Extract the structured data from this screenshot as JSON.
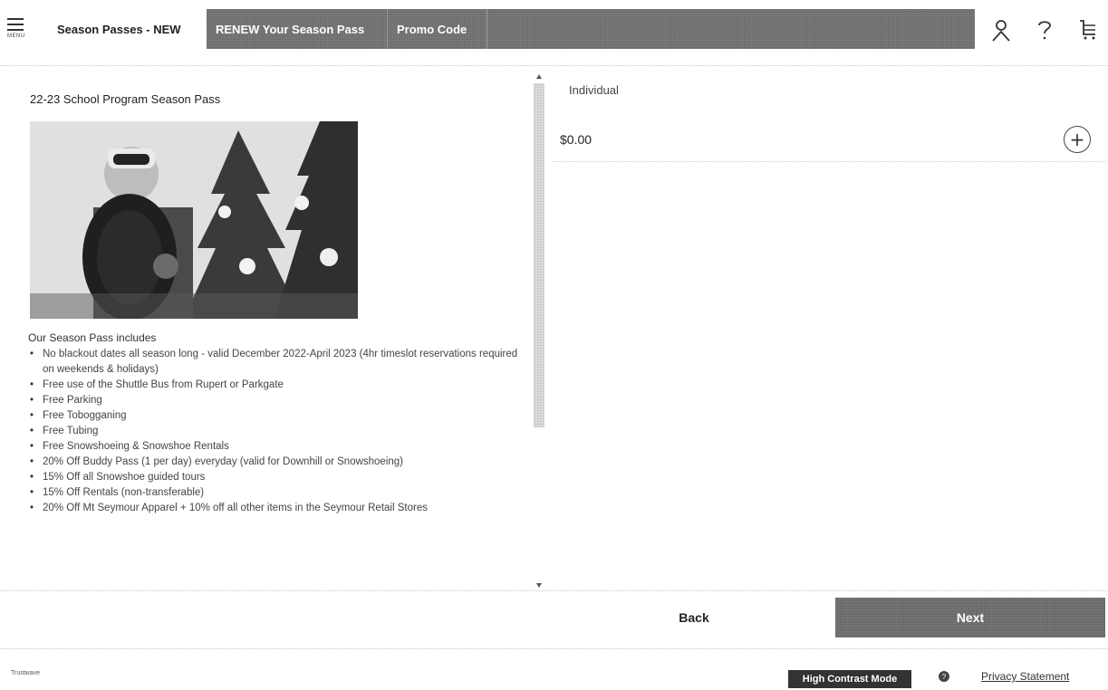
{
  "nav": {
    "menu_label": "MENU",
    "tabs": [
      {
        "label": "Season Passes - NEW"
      },
      {
        "label": "RENEW Your Season Pass"
      },
      {
        "label": "Promo Code"
      }
    ],
    "icons": [
      "user-icon",
      "help-icon",
      "cart-icon"
    ]
  },
  "product": {
    "title": "22-23 School Program Season Pass",
    "includes_heading": "Our Season Pass includes",
    "benefits": [
      "No blackout dates all season long - valid December 2022-April 2023 (4hr timeslot reservations required on weekends & holidays)",
      "Free use of the Shuttle Bus from Rupert or Parkgate",
      "Free Parking",
      "Free Tobogganing",
      "Free Tubing",
      "Free Snowshoeing & Snowshoe Rentals",
      "20% Off Buddy Pass (1 per day) everyday (valid for Downhill or Snowshoeing)",
      "15% Off all Snowshoe guided tours",
      "15% Off Rentals (non-transferable)",
      "20% Off Mt Seymour Apparel + 10% off all other items in the Seymour Retail Stores"
    ]
  },
  "pricing": {
    "label": "Individual",
    "price": "$0.00"
  },
  "actions": {
    "back": "Back",
    "next": "Next"
  },
  "footer": {
    "logo_text": "Trustwave",
    "high_contrast": "High Contrast Mode",
    "privacy": "Privacy Statement"
  }
}
